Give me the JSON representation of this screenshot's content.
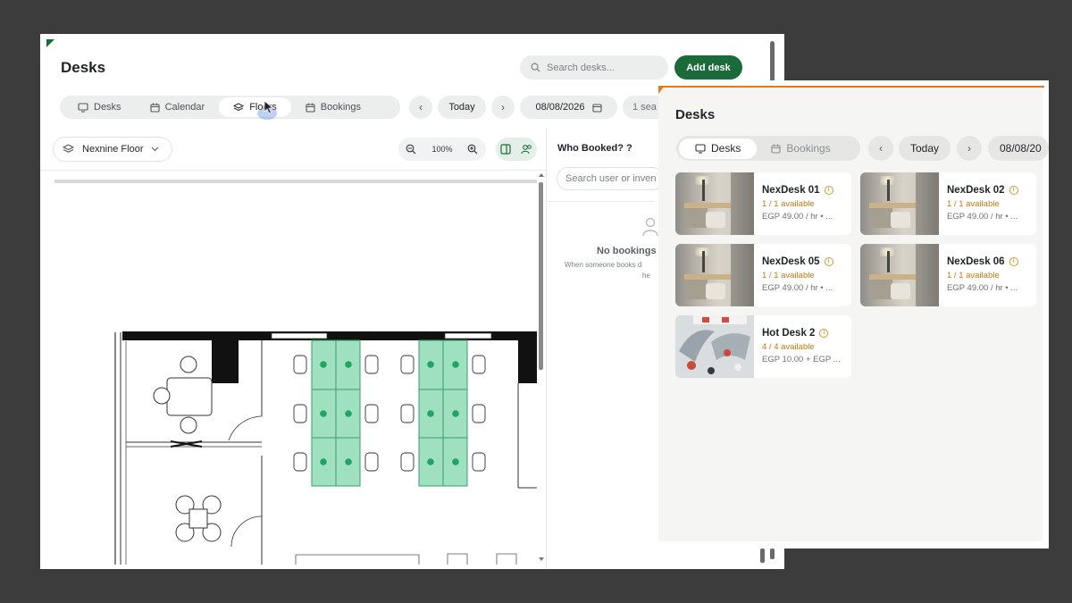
{
  "left_window": {
    "title": "Desks",
    "search_placeholder": "Search desks...",
    "add_button": "Add desk",
    "tabs": [
      {
        "label": "Desks",
        "icon": "monitor-icon",
        "active": false
      },
      {
        "label": "Calendar",
        "icon": "calendar-icon",
        "active": false
      },
      {
        "label": "Floors",
        "icon": "layers-icon",
        "active": true
      },
      {
        "label": "Bookings",
        "icon": "calendar-icon",
        "active": false
      }
    ],
    "nav": {
      "today": "Today",
      "date": "08/08/2026",
      "seats": "1 sea"
    },
    "floor_select": "Nexnine Floor",
    "zoom": "100%",
    "who_booked": {
      "title": "Who Booked? ?",
      "search_placeholder": "Search user or inven",
      "empty_title": "No bookings",
      "empty_sub": "When someone books d",
      "empty_sub2": "he"
    }
  },
  "right_window": {
    "title": "Desks",
    "tabs": [
      {
        "label": "Desks",
        "icon": "monitor-icon",
        "active": true
      },
      {
        "label": "Bookings",
        "icon": "calendar-icon",
        "active": false
      }
    ],
    "nav": {
      "today": "Today",
      "date": "08/08/20"
    },
    "desks": [
      {
        "name": "NexDesk 01",
        "availability": "1 / 1 available",
        "price": "EGP 49.00 / hr • ...",
        "thumb": "booth"
      },
      {
        "name": "NexDesk 02",
        "availability": "1 / 1 available",
        "price": "EGP 49.00 / hr • ...",
        "thumb": "booth"
      },
      {
        "name": "NexDesk 05",
        "availability": "1 / 1 available",
        "price": "EGP 49.00 / hr • ...",
        "thumb": "booth"
      },
      {
        "name": "NexDesk 06",
        "availability": "1 / 1 available",
        "price": "EGP 49.00 / hr • ...",
        "thumb": "booth"
      },
      {
        "name": "Hot Desk 2",
        "availability": "4 / 4 available",
        "price": "EGP 10.00 + EGP ...",
        "thumb": "hot-desk"
      }
    ]
  },
  "colors": {
    "brand_green": "#1b6b3a",
    "seat_green": "#9fe0c0",
    "seat_dot": "#1fa563",
    "availability": "#c67a12",
    "accent_orange": "#e07a1a",
    "background": "#3c3c3c"
  }
}
